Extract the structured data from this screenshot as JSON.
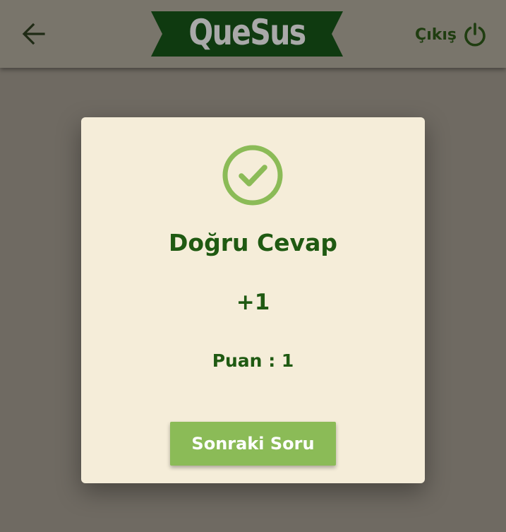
{
  "header": {
    "back_icon": "arrow-left-icon",
    "logo_text": "QueSus",
    "logout_label": "Çıkış",
    "logout_icon": "power-icon"
  },
  "result": {
    "icon": "check-circle-icon",
    "title": "Doğru Cevap",
    "delta": "+1",
    "score_label": "Puan",
    "score_separator": " : ",
    "score_value": "1",
    "next_button_label": "Sonraki Soru"
  },
  "colors": {
    "background": "#6f6a62",
    "header": "#79756b",
    "card": "#f5edd9",
    "accent_green": "#8bbb57",
    "text_dark_green": "#1f5a12",
    "logo_banner": "#0f3a10",
    "logo_text": "#a9a9a9"
  }
}
